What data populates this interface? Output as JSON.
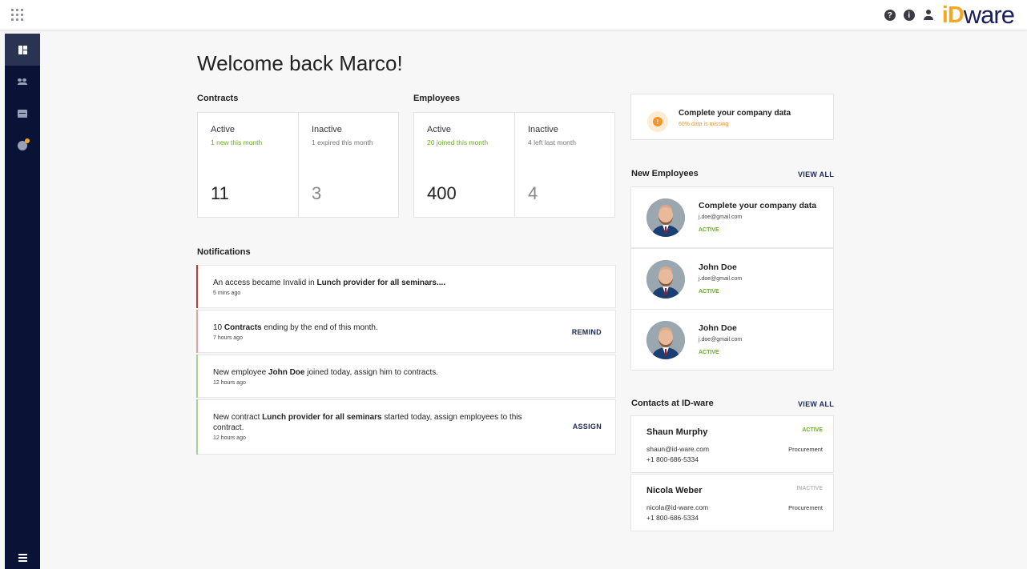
{
  "header": {
    "help_icon": "question-icon",
    "info_icon": "info-icon",
    "logo_prefix": "iD",
    "logo_suffix": "ware"
  },
  "sidebar": {
    "items": [
      {
        "icon": "dashboard-icon",
        "active": true
      },
      {
        "icon": "people-icon"
      },
      {
        "icon": "folder-icon"
      },
      {
        "icon": "info-icon",
        "badge": true
      }
    ],
    "menu_icon": "hamburger-icon"
  },
  "page": {
    "title": "Welcome back Marco!"
  },
  "contracts": {
    "title": "Contracts",
    "active": {
      "label": "Active",
      "sub": "1 new this month",
      "value": "11"
    },
    "inactive": {
      "label": "Inactive",
      "sub": "1 expired this month",
      "value": "3"
    }
  },
  "employees": {
    "title": "Employees",
    "active": {
      "label": "Active",
      "sub": "20 joined this month",
      "value": "400"
    },
    "inactive": {
      "label": "Inactive",
      "sub": "4 left last month",
      "value": "4"
    }
  },
  "notifications": {
    "title": "Notifications",
    "items": [
      {
        "pre": "An access became Invalid in ",
        "bold": "Lunch provider for all seminars....",
        "post": "",
        "time": "5 mins ago",
        "action": "",
        "color": "#c0392b"
      },
      {
        "pre": "10 ",
        "bold": "Contracts",
        "post": " ending by the end of this month.",
        "time": "7 hours ago",
        "action": "REMIND",
        "color": "#e8a0a0"
      },
      {
        "pre": "New employee ",
        "bold": "John Doe",
        "post": " joined today, assign him to contracts.",
        "time": "12 hours ago",
        "action": "",
        "color": "#a9d18e"
      },
      {
        "pre": "New contract ",
        "bold": "Lunch provider for all seminars",
        "post": " started today, assign employees to this contract.",
        "time": "12 hours ago",
        "action": "ASSIGN",
        "color": "#a9d18e"
      }
    ]
  },
  "company_alert": {
    "title": "Complete your company data",
    "sub": "60% data is missing",
    "icon": "exclamation-icon",
    "color": "#f0952a"
  },
  "new_employees": {
    "title": "New Employees",
    "view_all": "VIEW ALL",
    "items": [
      {
        "name": "Complete your company data",
        "email": "j.doe@gmail.com",
        "status": "ACTIVE"
      },
      {
        "name": "John Doe",
        "email": "j.doe@gmail.com",
        "status": "ACTIVE"
      },
      {
        "name": "John Doe",
        "email": "j.doe@gmail.com",
        "status": "ACTIVE"
      }
    ]
  },
  "contacts": {
    "title": "Contacts at ID-ware",
    "view_all": "VIEW ALL",
    "items": [
      {
        "name": "Shaun Murphy",
        "email": "shaun@id-ware.com",
        "phone": "+1 800-686-5334",
        "status": "ACTIVE",
        "department": "Procurement",
        "status_color": "#6aae1f"
      },
      {
        "name": "Nicola Weber",
        "email": "nicola@id-ware.com",
        "phone": "+1 800-686-5334",
        "status": "INACTIVE",
        "department": "Procurement",
        "status_color": "#bbbbbb"
      }
    ]
  }
}
